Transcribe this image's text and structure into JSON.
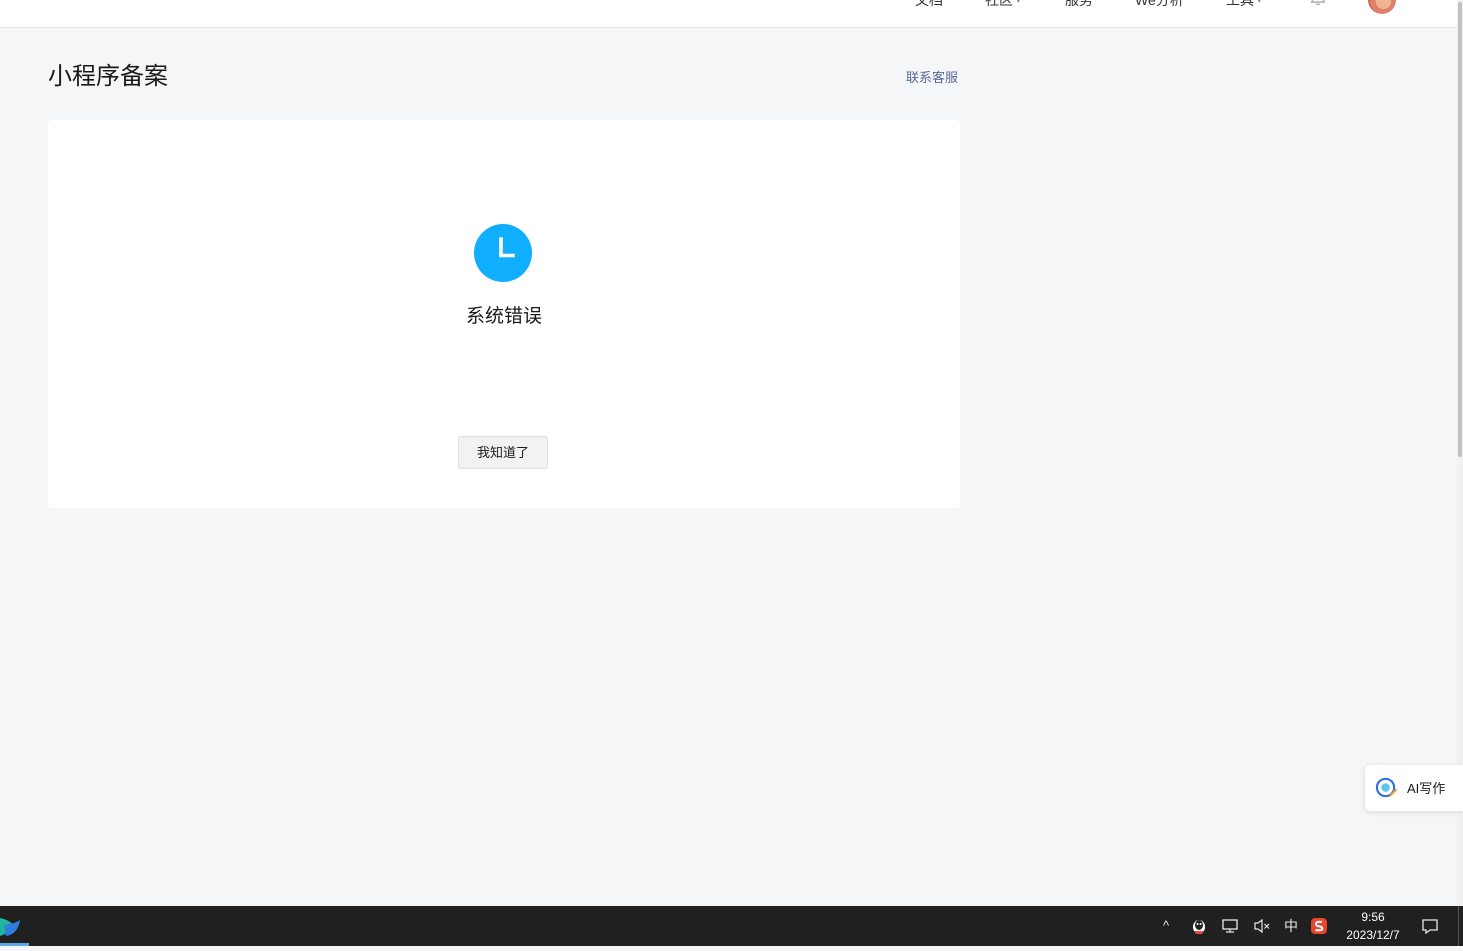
{
  "nav": {
    "items": [
      {
        "label": "文档",
        "caret": false
      },
      {
        "label": "社区",
        "caret": true
      },
      {
        "label": "服务",
        "caret": false
      },
      {
        "label": "We分析",
        "caret": false
      },
      {
        "label": "工具",
        "caret": true
      }
    ],
    "icons": {
      "bell": "bell-icon",
      "avatar": "user-avatar"
    }
  },
  "page": {
    "title": "小程序备案",
    "contact_label": "联系客服"
  },
  "status": {
    "icon": "clock-icon",
    "icon_color": "#10aeff",
    "message": "系统错误",
    "button_label": "我知道了"
  },
  "ai_widget": {
    "label": "AI写作",
    "icon": "ai-writing-icon"
  },
  "taskbar": {
    "tray": {
      "chevron": "^",
      "ime": "中"
    },
    "clock": {
      "time": "9:56",
      "date": "2023/12/7"
    }
  },
  "colors": {
    "page_bg": "#f5f6f7",
    "link": "#576b95",
    "accent": "#10aeff",
    "taskbar_bg": "#202020"
  }
}
